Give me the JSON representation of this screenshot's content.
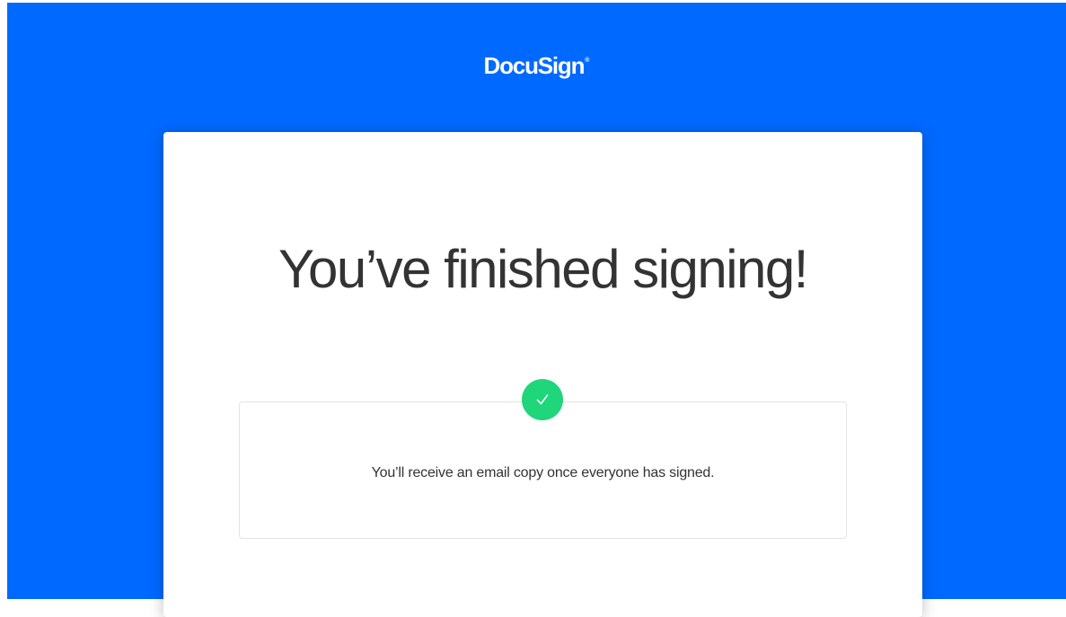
{
  "header": {
    "logo_text": "DocuSign",
    "logo_mark": "®",
    "background_color": "#0069ff"
  },
  "card": {
    "headline": "You’ve finished signing!",
    "message": "You’ll receive an email copy once everyone has signed.",
    "badge_icon": "checkmark-icon",
    "badge_color": "#1fd67a"
  }
}
